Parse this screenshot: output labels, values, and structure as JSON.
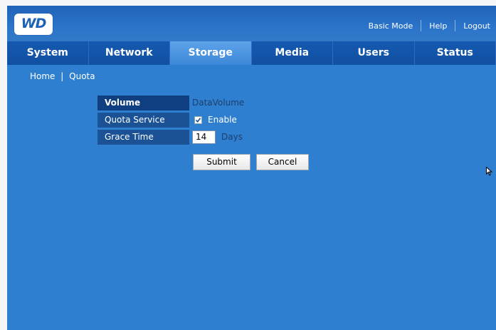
{
  "brand": {
    "logo_text": "WD",
    "logo_color": "#1c63b7"
  },
  "top_nav": {
    "basic_mode": "Basic Mode",
    "help": "Help",
    "logout": "Logout"
  },
  "tabs": [
    {
      "label": "System",
      "active": false
    },
    {
      "label": "Network",
      "active": false
    },
    {
      "label": "Storage",
      "active": true
    },
    {
      "label": "Media",
      "active": false
    },
    {
      "label": "Users",
      "active": false
    },
    {
      "label": "Status",
      "active": false
    }
  ],
  "breadcrumb": {
    "home": "Home",
    "separator": "|",
    "current": "Quota"
  },
  "form": {
    "volume_label": "Volume",
    "volume_value": "DataVolume",
    "quota_service_label": "Quota Service",
    "quota_enabled": true,
    "enable_label": "Enable",
    "grace_time_label": "Grace Time",
    "grace_time_value": "14",
    "grace_time_unit": "Days"
  },
  "buttons": {
    "submit": "Submit",
    "cancel": "Cancel"
  },
  "colors": {
    "background": "#2f7fd0",
    "tab_bar": "#1459b0",
    "active_tab": "#4a95e0",
    "label_cell": "#1b5296",
    "label_head": "#0f3f80"
  }
}
